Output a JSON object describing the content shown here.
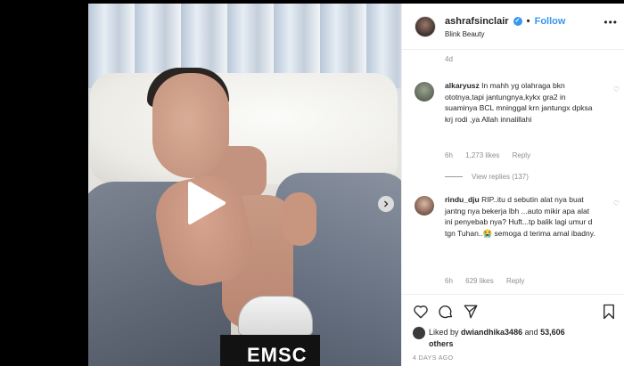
{
  "post": {
    "username": "ashrafsinclair",
    "follow_label": "Follow",
    "location": "Blink Beauty",
    "caption_time": "4d",
    "device_label": "EMSC",
    "liked_by_prefix": "Liked by",
    "liked_by_user": "dwiandhika3486",
    "liked_by_and": "and",
    "likes_count": "53,606 others",
    "posted_date": "4 DAYS AGO"
  },
  "comments": [
    {
      "username": "alkaryusz",
      "text": "In mahh yg olahraga bkn ototnya,tapi jantungnya,kykx gra2 in suaminya BCL mninggal krn jantungx dpksa krj rodi ,ya Allah innalillahi",
      "time": "6h",
      "likes": "1,273 likes",
      "reply_label": "Reply"
    },
    {
      "username": "rindu_dju",
      "text": "RIP..itu d sebutin alat nya buat jantng nya bekerja lbh ...auto mikir apa alat ini penyebab nya? Huft...tp balik lagi umur d tgn Tuhan..😭 semoga d terima amal ibadny.",
      "time": "6h",
      "likes": "629 likes",
      "reply_label": "Reply"
    }
  ],
  "view_replies": "View replies (137)",
  "icons": [
    "play-icon",
    "chevron-right-icon",
    "verified-icon",
    "more-icon",
    "heart-icon",
    "comment-icon",
    "share-icon",
    "bookmark-icon"
  ],
  "colors": {
    "accent": "#3897f0",
    "text": "#262626",
    "muted": "#8e8e8e"
  }
}
